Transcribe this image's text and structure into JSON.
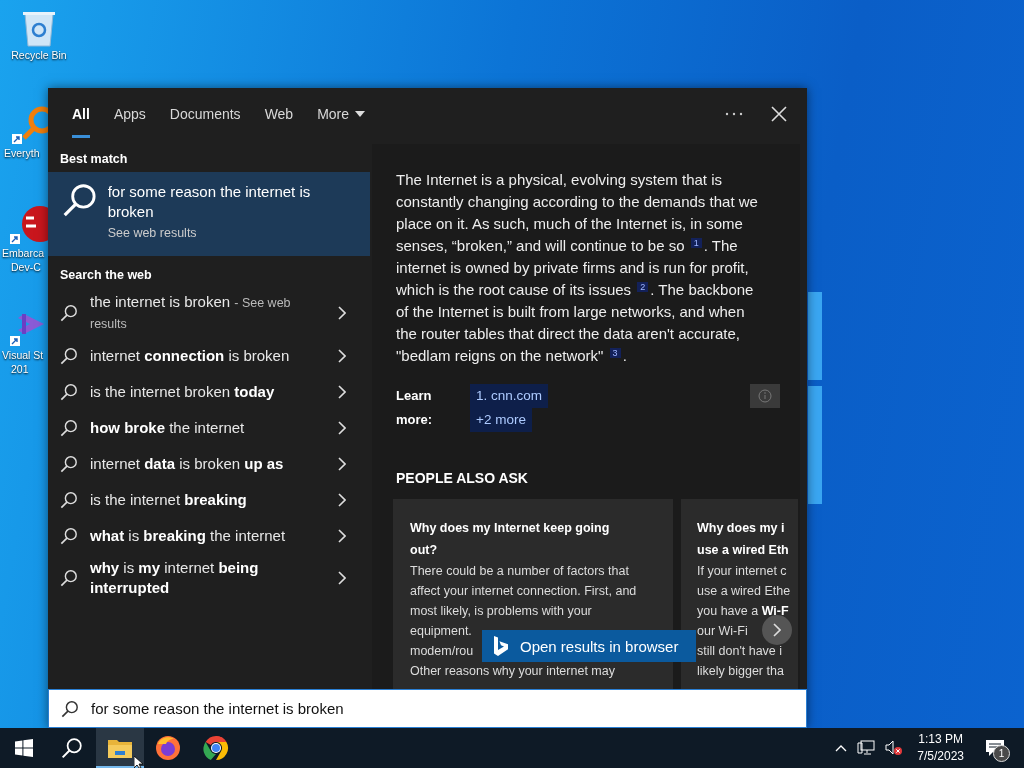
{
  "desktop_icons": [
    {
      "kind": "recycle",
      "lines": [
        "Recycle Bin"
      ]
    },
    {
      "kind": "magnifier",
      "lines": [
        "Everyth"
      ]
    },
    {
      "kind": "devcpp",
      "lines": [
        "Embarca",
        "Dev-C"
      ]
    },
    {
      "kind": "studio",
      "lines": [
        "Visual St",
        "201"
      ]
    }
  ],
  "search_panel": {
    "tabs": [
      {
        "label": "All",
        "selected": true,
        "kind": "tab"
      },
      {
        "label": "Apps",
        "selected": false,
        "kind": "tab"
      },
      {
        "label": "Documents",
        "selected": false,
        "kind": "tab"
      },
      {
        "label": "Web",
        "selected": false,
        "kind": "tab"
      },
      {
        "label": "More",
        "selected": false,
        "kind": "menu"
      }
    ],
    "best_match": {
      "heading": "Best match",
      "title": "for some reason the internet is broken",
      "subtitle": "See web results",
      "selected": true
    },
    "web_heading": "Search the web",
    "suggestions": [
      {
        "text": "the internet is broken",
        "note": "- See web results"
      },
      {
        "text": "internet **connection** is broken"
      },
      {
        "text": "is the internet broken **today**"
      },
      {
        "text": "**how broke** the internet"
      },
      {
        "text": "internet **data** is broken **up as**"
      },
      {
        "text": "is the internet **breaking**"
      },
      {
        "text": "**what** is **breaking** the internet"
      },
      {
        "text": "**why** is **my** internet **being interrupted**"
      }
    ],
    "answer": {
      "text": "The Internet is a physical, evolving system that is constantly changing according to the demands that we place on it. As such, much of the Internet is, in some senses, “broken,” and will continue to be so $^{1}$. The internet is owned by private firms and is run for profit, which is the root cause of its issues $^{2}$. The backbone of the Internet is built from large networks, and when the router tables that direct the data aren't accurate, \"bedlam reigns on the network\" $^{3}$.",
      "learn_more": "Learn more:",
      "links": [
        "1. cnn.com",
        "+2 more"
      ]
    },
    "people_also_ask": {
      "heading": "PEOPLE ALSO ASK",
      "cards": [
        {
          "title_lines": [
            "Why does my Internet keep going",
            "out?"
          ],
          "lines": [
            "There could be a number of factors that",
            "affect your internet connection. First, and",
            "most likely, is problems with your",
            "equipment.",
            "modem/rou",
            "Other reasons why your internet may"
          ]
        },
        {
          "title_lines": [
            "Why does my i",
            "use a wired Eth"
          ],
          "lines": [
            "If your internet c",
            "use a wired Ethe",
            "you have a **Wi-F**",
            "our Wi-Fi",
            "still don't have i",
            "likely bigger tha"
          ]
        }
      ]
    },
    "open_button": "Open results in browser",
    "search_box": {
      "value": "for some reason the internet is broken"
    }
  },
  "taskbar": {
    "apps": [
      {
        "kind": "explorer",
        "selected": true
      },
      {
        "kind": "firefox",
        "selected": false
      },
      {
        "kind": "chrome",
        "selected": false
      }
    ],
    "time": "1:13 PM",
    "date": "7/5/2023",
    "notifications": "1"
  }
}
